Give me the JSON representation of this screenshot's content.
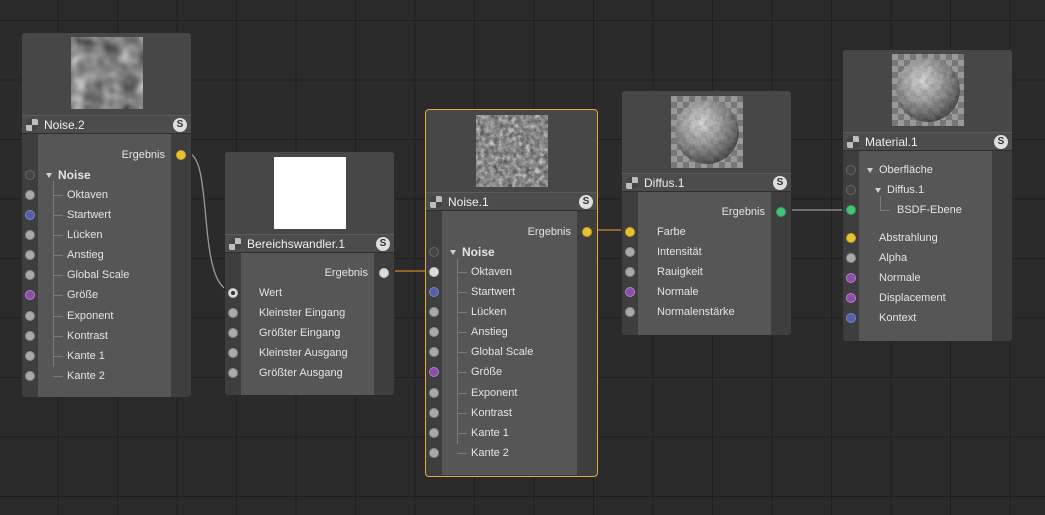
{
  "nodes": {
    "noise2": {
      "title": "Noise.2",
      "output": "Ergebnis",
      "group": "Noise",
      "inputs": [
        "Oktaven",
        "Startwert",
        "Lücken",
        "Anstieg",
        "Global Scale",
        "Größe",
        "Exponent",
        "Kontrast",
        "Kante 1",
        "Kante 2"
      ]
    },
    "bereichswandler1": {
      "title": "Bereichswandler.1",
      "output": "Ergebnis",
      "inputs": [
        "Wert",
        "Kleinster Eingang",
        "Größter Eingang",
        "Kleinster Ausgang",
        "Größter Ausgang"
      ]
    },
    "noise1": {
      "title": "Noise.1",
      "output": "Ergebnis",
      "group": "Noise",
      "inputs": [
        "Oktaven",
        "Startwert",
        "Lücken",
        "Anstieg",
        "Global Scale",
        "Größe",
        "Exponent",
        "Kontrast",
        "Kante 1",
        "Kante 2"
      ]
    },
    "diffus1": {
      "title": "Diffus.1",
      "output": "Ergebnis",
      "inputs": [
        "Farbe",
        "Intensität",
        "Rauigkeit",
        "Normale",
        "Normalenstärke"
      ]
    },
    "material1": {
      "title": "Material.1",
      "tree": [
        "Oberfläche",
        "Diffus.1",
        "BSDF-Ebene"
      ],
      "inputs": [
        "Abstrahlung",
        "Alpha",
        "Normale",
        "Displacement",
        "Kontext"
      ]
    }
  },
  "header_badge": "S",
  "colors": {
    "selection": "#e8a93a",
    "wire": "#9a9a9a",
    "port_color": "#e6c234",
    "port_vector": "#5561a6",
    "port_size": "#8d4ea8",
    "port_bsdf": "#48c279"
  },
  "icons": [
    "texture-icon",
    "solo-icon"
  ]
}
